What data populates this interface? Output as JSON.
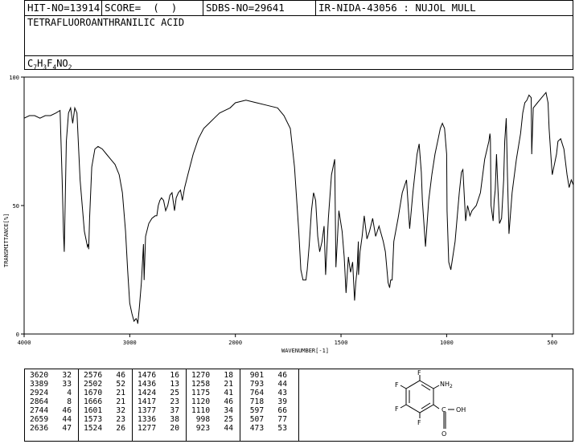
{
  "header": {
    "hit_no": "HIT-NO=13914",
    "score": "SCORE=  (  )",
    "sdbs_no": "SDBS-NO=29641",
    "ir_nida": "IR-NIDA-43056 : NUJOL MULL"
  },
  "compound_name": "TETRAFLUOROANTHRANILIC ACID",
  "formula": {
    "c": "C",
    "c_n": "7",
    "h": "H",
    "h_n": "3",
    "f": "F",
    "f_n": "4",
    "rest": "NO",
    "o_n": "2"
  },
  "chart_data": {
    "type": "line",
    "xlabel": "WAVENUMBER[-1]",
    "ylabel": "TRANSMITTANCE[%]",
    "xlim": [
      4000,
      400
    ],
    "ylim": [
      0,
      100
    ],
    "x_ticks": [
      "4000",
      "3000",
      "2000",
      "1500",
      "1000",
      "500"
    ],
    "y_ticks": [
      "0",
      "50",
      "100"
    ],
    "series": [
      {
        "x": [
          4000,
          3950,
          3900,
          3850,
          3800,
          3750,
          3700,
          3660,
          3640,
          3628,
          3620,
          3612,
          3600,
          3580,
          3560,
          3540,
          3520,
          3500,
          3470,
          3430,
          3400,
          3392,
          3389,
          3380,
          3360,
          3330,
          3300,
          3260,
          3220,
          3180,
          3140,
          3100,
          3070,
          3040,
          3020,
          3000,
          2980,
          2960,
          2940,
          2928,
          2924,
          2910,
          2890,
          2870,
          2864,
          2850,
          2820,
          2790,
          2760,
          2744,
          2730,
          2715,
          2700,
          2680,
          2660,
          2640,
          2620,
          2600,
          2576,
          2560,
          2540,
          2520,
          2502,
          2480,
          2450,
          2400,
          2350,
          2300,
          2250,
          2200,
          2150,
          2100,
          2050,
          2000,
          1950,
          1900,
          1850,
          1800,
          1770,
          1740,
          1720,
          1700,
          1690,
          1680,
          1670,
          1666,
          1660,
          1650,
          1640,
          1630,
          1620,
          1610,
          1601,
          1590,
          1580,
          1573,
          1560,
          1545,
          1530,
          1524,
          1510,
          1495,
          1485,
          1476,
          1465,
          1455,
          1445,
          1436,
          1430,
          1424,
          1418,
          1417,
          1410,
          1400,
          1390,
          1377,
          1365,
          1350,
          1336,
          1320,
          1300,
          1290,
          1277,
          1270,
          1265,
          1258,
          1250,
          1230,
          1210,
          1190,
          1175,
          1160,
          1140,
          1130,
          1120,
          1115,
          1110,
          1100,
          1085,
          1070,
          1055,
          1040,
          1030,
          1020,
          1010,
          1000,
          998,
          990,
          980,
          960,
          940,
          930,
          923,
          910,
          901,
          895,
          890,
          880,
          860,
          840,
          820,
          800,
          795,
          793,
          790,
          780,
          775,
          770,
          764,
          760,
          750,
          740,
          730,
          725,
          718,
          712,
          705,
          690,
          670,
          650,
          640,
          630,
          620,
          610,
          600,
          597,
          590,
          570,
          550,
          540,
          530,
          525,
          520,
          515,
          507,
          500,
          490,
          480,
          473,
          460,
          445,
          430,
          420,
          410,
          400
        ],
        "y": [
          84,
          85,
          85,
          84,
          85,
          85,
          86,
          87,
          60,
          40,
          32,
          50,
          75,
          86,
          88,
          82,
          88,
          86,
          60,
          40,
          34,
          35,
          33,
          45,
          65,
          72,
          73,
          72,
          70,
          68,
          66,
          62,
          55,
          40,
          25,
          12,
          8,
          5,
          6,
          5,
          4,
          10,
          20,
          35,
          21,
          38,
          43,
          45,
          46,
          46,
          50,
          52,
          53,
          52,
          48,
          50,
          54,
          55,
          48,
          53,
          55,
          56,
          52,
          57,
          62,
          70,
          76,
          80,
          82,
          84,
          86,
          87,
          88,
          90,
          91,
          90,
          89,
          88,
          85,
          80,
          65,
          40,
          25,
          21,
          21,
          21,
          25,
          35,
          48,
          55,
          52,
          38,
          32,
          36,
          42,
          23,
          45,
          62,
          68,
          26,
          48,
          40,
          30,
          16,
          30,
          24,
          28,
          13,
          20,
          25,
          36,
          23,
          32,
          38,
          46,
          37,
          40,
          45,
          38,
          42,
          36,
          32,
          20,
          18,
          21,
          21,
          36,
          45,
          55,
          60,
          41,
          55,
          70,
          74,
          63,
          52,
          46,
          34,
          52,
          62,
          70,
          76,
          80,
          82,
          80,
          70,
          48,
          28,
          25,
          36,
          55,
          63,
          64,
          44,
          50,
          48,
          46,
          48,
          50,
          55,
          68,
          75,
          78,
          76,
          50,
          44,
          52,
          56,
          70,
          62,
          43,
          45,
          60,
          75,
          84,
          62,
          39,
          55,
          68,
          78,
          86,
          90,
          91,
          93,
          92,
          70,
          88,
          90,
          92,
          93,
          94,
          92,
          90,
          80,
          70,
          62,
          66,
          70,
          75,
          76,
          72,
          62,
          57,
          60,
          58
        ]
      }
    ]
  },
  "peak_table": [
    [
      [
        "3620",
        "32"
      ],
      [
        "3389",
        "33"
      ],
      [
        "2924",
        "4"
      ],
      [
        "2864",
        "8"
      ],
      [
        "2744",
        "46"
      ],
      [
        "2659",
        "44"
      ],
      [
        "2636",
        "47"
      ]
    ],
    [
      [
        "2576",
        "46"
      ],
      [
        "2502",
        "52"
      ],
      [
        "1670",
        "21"
      ],
      [
        "1666",
        "21"
      ],
      [
        "1601",
        "32"
      ],
      [
        "1573",
        "23"
      ],
      [
        "1524",
        "26"
      ]
    ],
    [
      [
        "1476",
        "16"
      ],
      [
        "1436",
        "13"
      ],
      [
        "1424",
        "25"
      ],
      [
        "1417",
        "23"
      ],
      [
        "1377",
        "37"
      ],
      [
        "1336",
        "38"
      ],
      [
        "1277",
        "20"
      ]
    ],
    [
      [
        "1270",
        "18"
      ],
      [
        "1258",
        "21"
      ],
      [
        "1175",
        "41"
      ],
      [
        "1120",
        "46"
      ],
      [
        "1110",
        "34"
      ],
      [
        "998",
        "25"
      ],
      [
        "923",
        "44"
      ]
    ],
    [
      [
        "901",
        "46"
      ],
      [
        "793",
        "44"
      ],
      [
        "764",
        "43"
      ],
      [
        "718",
        "39"
      ],
      [
        "597",
        "66"
      ],
      [
        "507",
        "77"
      ],
      [
        "473",
        "53"
      ]
    ]
  ],
  "structure_labels": {
    "f1": "F",
    "f2": "F",
    "f3": "F",
    "f4": "F",
    "nh2": "NH",
    "nh2_sub": "2",
    "oh": "OH",
    "o": "O",
    "c": "C"
  }
}
